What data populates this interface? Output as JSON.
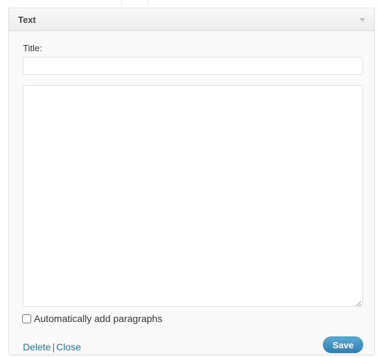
{
  "widget": {
    "title": "Text",
    "title_field": {
      "label": "Title:",
      "value": "",
      "placeholder": ""
    },
    "content": {
      "value": "",
      "placeholder": ""
    },
    "autop": {
      "label": "Automatically add paragraphs",
      "checked": false
    },
    "actions": {
      "delete_label": "Delete",
      "separator": "|",
      "close_label": "Close",
      "save_label": "Save"
    }
  },
  "icons": {
    "toggle": "triangle-down-icon",
    "resize": "resize-grip-icon"
  },
  "colors": {
    "link": "#21759b",
    "save_button": "#2e7fb2"
  }
}
